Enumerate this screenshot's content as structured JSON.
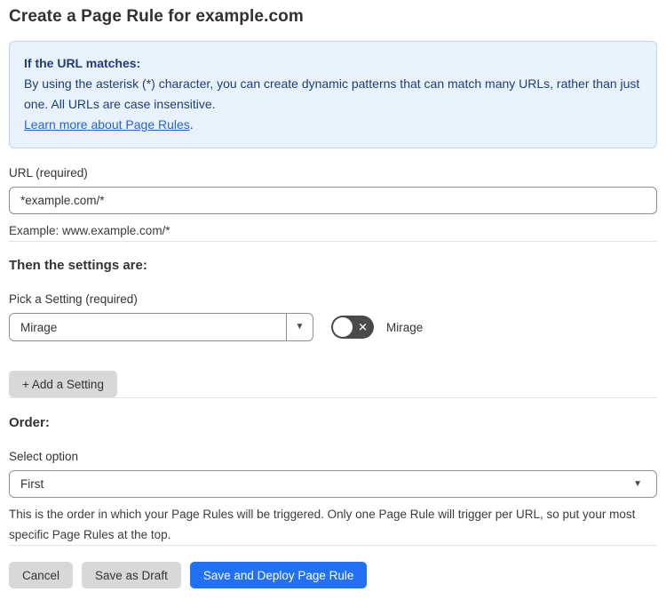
{
  "page": {
    "title": "Create a Page Rule for example.com"
  },
  "info_box": {
    "heading": "If the URL matches:",
    "body": "By using the asterisk (*) character, you can create dynamic patterns that can match many URLs, rather than just one. All URLs are case insensitive.",
    "link_label": "Learn more about Page Rules",
    "link_suffix": "."
  },
  "url_field": {
    "label": "URL (required)",
    "value": "*example.com/*",
    "helper": "Example: www.example.com/*"
  },
  "settings_section": {
    "heading": "Then the settings are:",
    "picker_label": "Pick a Setting (required)",
    "picker_value": "Mirage",
    "toggle_label": "Mirage",
    "toggle_state": "off",
    "add_setting_label": "+ Add a Setting"
  },
  "order_section": {
    "heading": "Order:",
    "select_label": "Select option",
    "select_value": "First",
    "helper": "This is the order in which your Page Rules will be triggered. Only one Page Rule will trigger per URL, so put your most specific Page Rules at the top."
  },
  "actions": {
    "cancel_label": "Cancel",
    "save_draft_label": "Save as Draft",
    "save_deploy_label": "Save and Deploy Page Rule"
  },
  "icons": {
    "dropdown_arrow": "▼",
    "toggle_x": "✕"
  },
  "colors": {
    "info_background": "#e8f2fc",
    "info_border": "#b9d7f5",
    "info_text": "#1f3d77",
    "link_blue": "#2563d9",
    "primary_button_blue": "#2270f3",
    "secondary_button_gray": "#d8d8d8",
    "toggle_off_gray": "#4a4a4a"
  }
}
